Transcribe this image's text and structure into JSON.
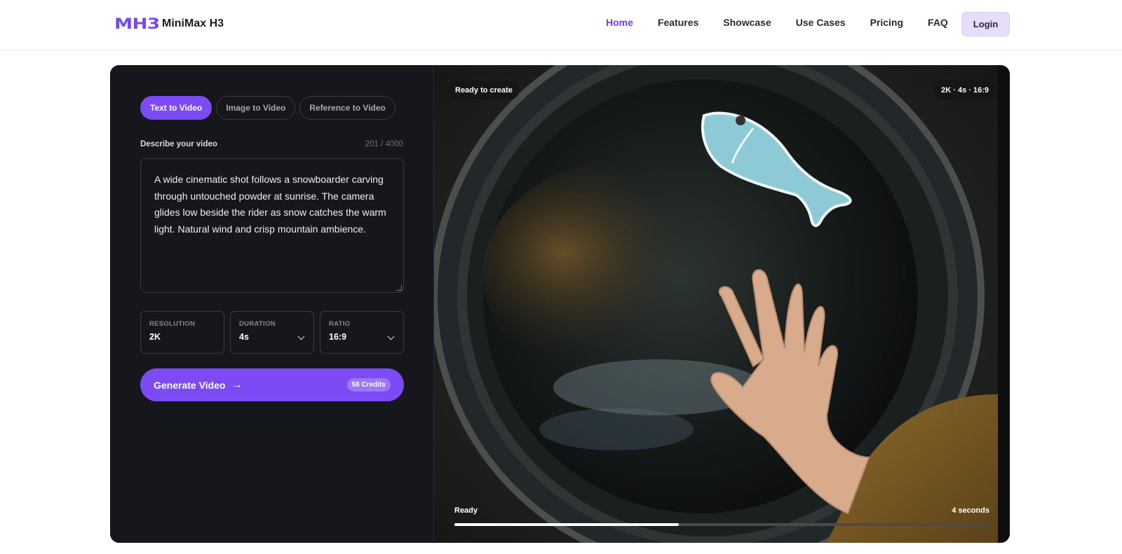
{
  "header": {
    "logo_mark": "MH3",
    "logo_text": "MiniMax H3",
    "nav": [
      "Home",
      "Features",
      "Showcase",
      "Use Cases",
      "Pricing",
      "FAQ"
    ],
    "login_label": "Login",
    "accent_color": "#7c4bf5"
  },
  "editor": {
    "tabs": [
      "Text to Video",
      "Image to Video",
      "Reference to Video"
    ],
    "description_label": "Describe your video",
    "char_count": "201 / 4000",
    "prompt": "A wide cinematic shot follows a snowboarder carving through untouched powder at sunrise. The camera glides low beside the rider as snow catches the warm light. Natural wind and crisp mountain ambience.",
    "options": {
      "resolution": {
        "label": "RESOLUTION",
        "value": "2K"
      },
      "duration": {
        "label": "DURATION",
        "value": "4s"
      },
      "ratio": {
        "label": "RATIO",
        "value": "16:9"
      }
    },
    "generate_label": "Generate Video",
    "credits_label": "56 Credits"
  },
  "preview": {
    "status_pill": "Ready to create",
    "spec_pill": "2K · 4s · 16:9",
    "state_label": "Ready",
    "duration_label": "4 seconds",
    "progress": 0.42
  }
}
